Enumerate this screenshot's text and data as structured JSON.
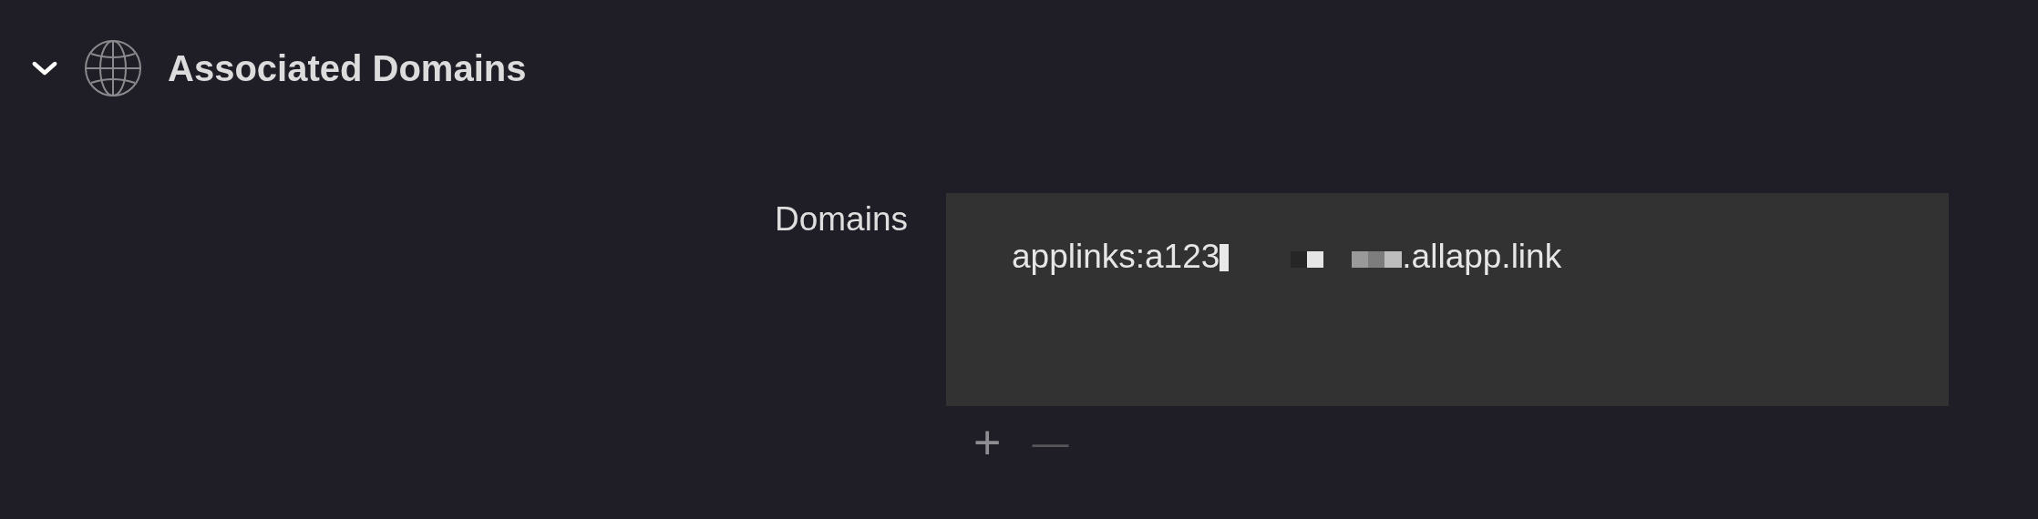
{
  "section": {
    "title": "Associated Domains",
    "expanded": true
  },
  "field": {
    "label": "Domains",
    "entries": [
      {
        "visible_start": "applinks:a123",
        "visible_end": ".allapp.link",
        "redacted": true
      }
    ]
  },
  "controls": {
    "add": "+",
    "remove": "—"
  }
}
